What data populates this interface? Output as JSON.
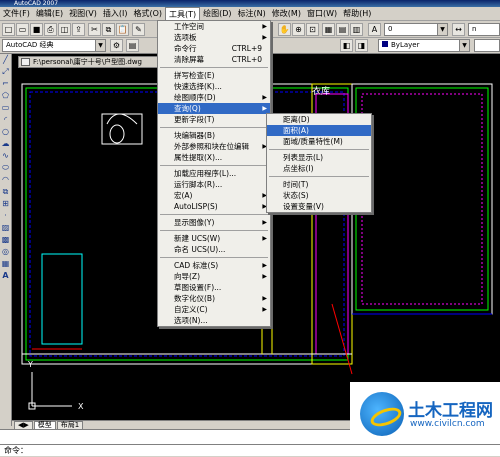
{
  "window": {
    "title": "AutoCAD 2007"
  },
  "menubar": [
    "文件(F)",
    "编辑(E)",
    "视图(V)",
    "插入(I)",
    "格式(O)",
    "工具(T)",
    "绘图(D)",
    "标注(N)",
    "修改(M)",
    "窗口(W)",
    "帮助(H)"
  ],
  "toolbar": {
    "workspace": "AutoCAD 经典",
    "layer_value": "0",
    "linetype": "ByLayer",
    "lineweight_short": "n"
  },
  "document": {
    "title": "F:\\personal\\庸宁十号\\户型图.dwg"
  },
  "canvas": {
    "room_label": "衣库",
    "x_axis": "X",
    "y_axis": "Y"
  },
  "tools_menu": {
    "items": [
      {
        "label": "工作空间",
        "sub": true
      },
      {
        "label": "选项板",
        "sub": true
      },
      {
        "label": "命令行",
        "shortcut": "CTRL+9"
      },
      {
        "label": "清除屏幕",
        "shortcut": "CTRL+0"
      },
      {
        "sep": true
      },
      {
        "label": "拼写检查(E)"
      },
      {
        "label": "快速选择(K)..."
      },
      {
        "label": "绘图顺序(D)",
        "sub": true
      },
      {
        "label": "查询(Q)",
        "sub": true,
        "hl": true
      },
      {
        "label": "更新字段(T)"
      },
      {
        "sep": true
      },
      {
        "label": "块编辑器(B)"
      },
      {
        "label": "外部参照和块在位编辑",
        "sub": true
      },
      {
        "label": "属性提取(X)..."
      },
      {
        "sep": true
      },
      {
        "label": "加载应用程序(L)..."
      },
      {
        "label": "运行脚本(R)..."
      },
      {
        "label": "宏(A)",
        "sub": true
      },
      {
        "label": "AutoLISP(S)",
        "sub": true
      },
      {
        "sep": true
      },
      {
        "label": "显示图像(Y)",
        "sub": true
      },
      {
        "sep": true
      },
      {
        "label": "新建 UCS(W)",
        "sub": true
      },
      {
        "label": "命名 UCS(U)..."
      },
      {
        "sep": true
      },
      {
        "label": "CAD 标准(S)",
        "sub": true
      },
      {
        "label": "向导(Z)",
        "sub": true
      },
      {
        "label": "草图设置(F)..."
      },
      {
        "label": "数字化仪(B)",
        "sub": true
      },
      {
        "label": "自定义(C)",
        "sub": true
      },
      {
        "label": "选项(N)..."
      }
    ]
  },
  "query_submenu": {
    "items": [
      {
        "label": "距离(D)"
      },
      {
        "label": "面积(A)",
        "hl": true
      },
      {
        "label": "面域/质量特性(M)"
      },
      {
        "sep": true
      },
      {
        "label": "列表显示(L)"
      },
      {
        "label": "点坐标(I)"
      },
      {
        "sep": true
      },
      {
        "label": "时间(T)"
      },
      {
        "label": "状态(S)"
      },
      {
        "label": "设置变量(V)"
      }
    ]
  },
  "tabs": [
    "模型",
    "布局1"
  ],
  "command": {
    "prompt": "命令："
  },
  "watermark": {
    "title": "土木工程网",
    "url": "www.civilcn.com"
  },
  "colors": {
    "highlight": "#316ac5",
    "canvas": "#000000",
    "brand": "#1565c0"
  }
}
